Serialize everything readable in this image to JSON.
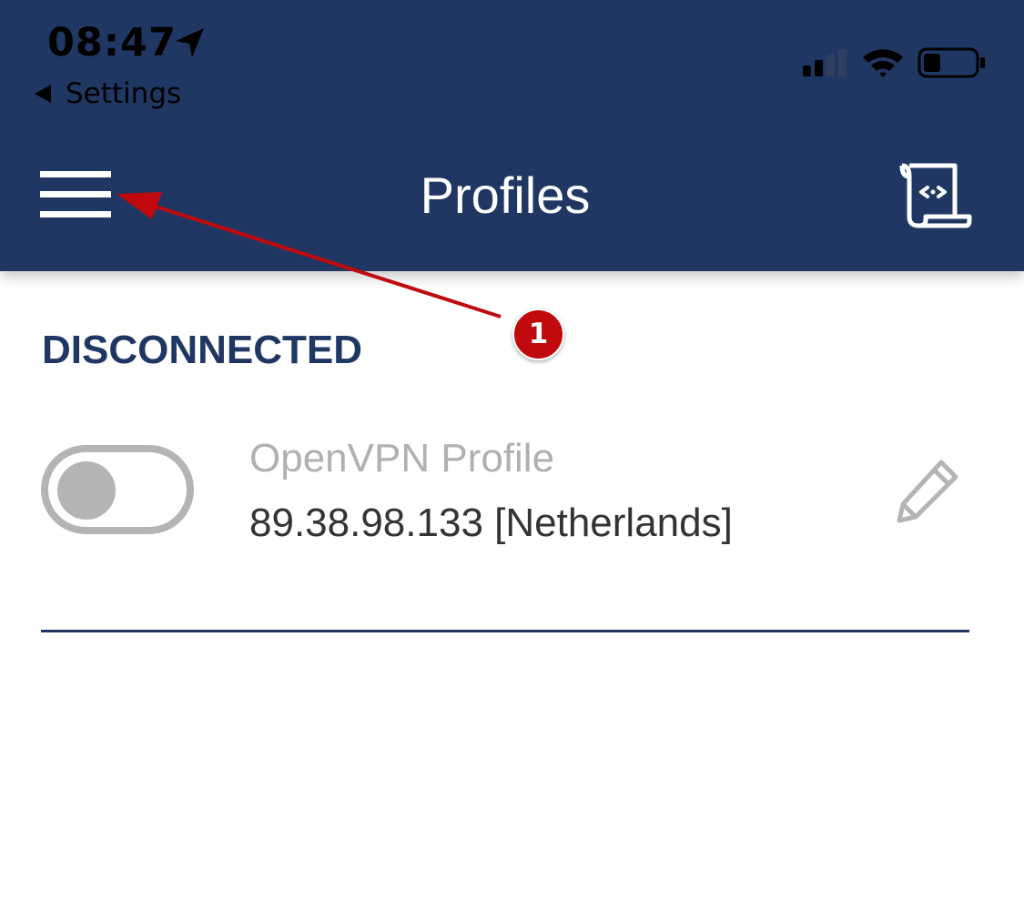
{
  "status_bar": {
    "time": "08:47",
    "back_label": "Settings",
    "location_icon": "location-arrow-icon",
    "signal_icon": "cellular-signal-icon",
    "wifi_icon": "wifi-icon",
    "battery_icon": "battery-low-icon"
  },
  "header": {
    "title": "Profiles",
    "menu_icon": "hamburger-menu-icon",
    "import_icon": "import-profile-scroll-icon"
  },
  "connection": {
    "status": "DISCONNECTED"
  },
  "profiles": [
    {
      "name": "OpenVPN Profile",
      "server": "89.38.98.133 [Netherlands]",
      "connected": false,
      "edit_icon": "pencil-icon"
    }
  ],
  "annotation": {
    "number": "1"
  },
  "colors": {
    "header_bg": "#213763",
    "accent_navy": "#213763",
    "annotation_red": "#c0090c",
    "toggle_off": "#b4b4b4",
    "profile_name_gray": "#b0b0b0",
    "server_text": "#333333"
  }
}
